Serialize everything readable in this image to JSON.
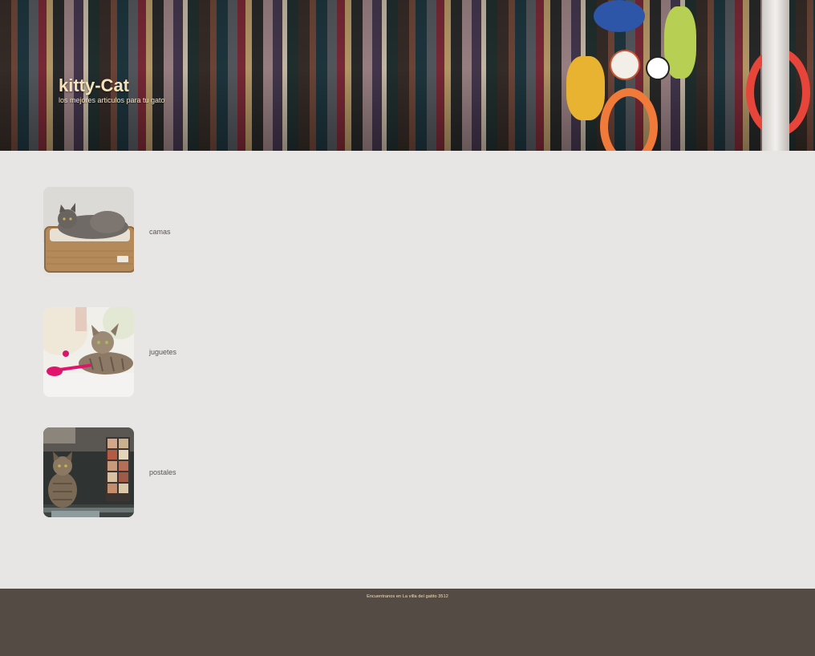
{
  "header": {
    "title": "kitty-Cat",
    "subtitle": "los mejores articulos para tu gato"
  },
  "categories": [
    {
      "label": "camas",
      "image": "cat-on-bed-photo"
    },
    {
      "label": "juguetes",
      "image": "kitten-with-toy-photo"
    },
    {
      "label": "postales",
      "image": "cat-with-postcards-photo"
    }
  ],
  "footer": {
    "text": "Encuentranos en La villa del gatito 3512"
  },
  "colors": {
    "background": "#e8e6e4",
    "accent_text": "#f6e2b8",
    "footer_bg": "#554b45",
    "label_text": "#5b5450"
  }
}
